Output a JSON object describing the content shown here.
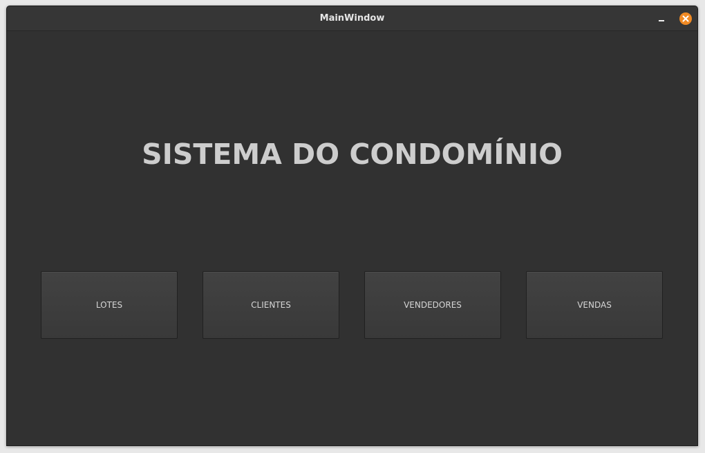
{
  "window": {
    "title": "MainWindow"
  },
  "main": {
    "heading": "SISTEMA DO CONDOMÍNIO",
    "buttons": [
      {
        "label": "LOTES"
      },
      {
        "label": "CLIENTES"
      },
      {
        "label": "VENDEDORES"
      },
      {
        "label": "VENDAS"
      }
    ]
  },
  "colors": {
    "background": "#313131",
    "titlebar": "#363636",
    "close_button": "#f08a24",
    "heading_text": "#cdcdcd"
  },
  "icons": {
    "minimize": "minimize-icon",
    "close": "close-icon"
  }
}
